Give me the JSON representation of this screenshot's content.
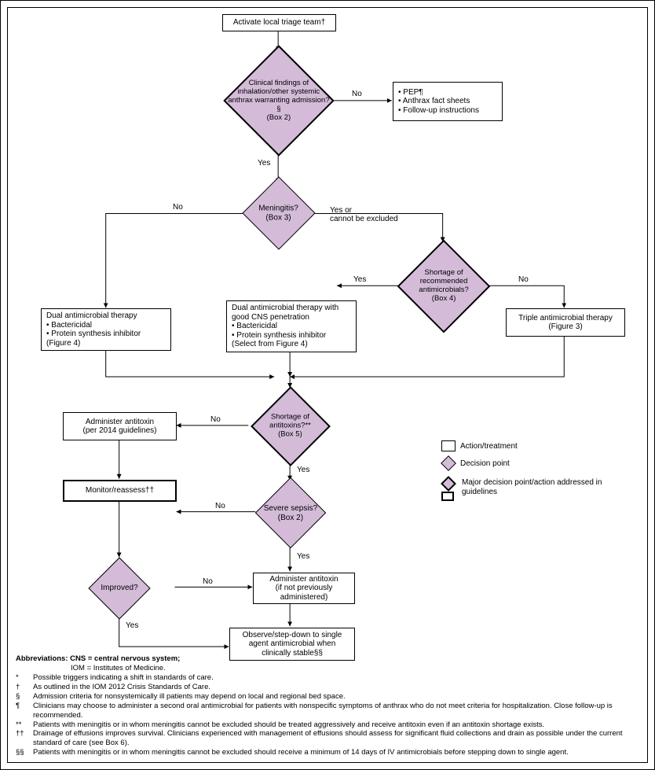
{
  "nodes": {
    "start": "Activate local triage team†",
    "d1": "Clinical findings of inhalation/other systemic anthrax warranting admission?§\n(Box 2)",
    "out_no1_a": "PEP¶",
    "out_no1_b": "Anthrax fact sheets",
    "out_no1_c": "Follow-up instructions",
    "d2": "Meningitis?\n(Box 3)",
    "d3": "Shortage of recommended antimicrobials?\n(Box 4)",
    "box_dual": "Dual antimicrobial therapy",
    "box_dual_a": "Bactericidal",
    "box_dual_b": "Protein synthesis inhibitor\n(Figure 4)",
    "box_dualcns": "Dual antimicrobial therapy with good CNS penetration",
    "box_dualcns_a": "Bactericidal",
    "box_dualcns_b": "Protein synthesis inhibitor\n(Select from Figure 4)",
    "box_triple": "Triple antimicrobial therapy\n(Figure 3)",
    "d4": "Shortage of antitoxins?**\n(Box 5)",
    "box_admin_anti": "Administer antitoxin\n(per 2014 guidelines)",
    "box_monitor": "Monitor/reassess††",
    "d5": "Severe sepsis?\n(Box 2)",
    "d6": "Improved?",
    "box_admin2": "Administer antitoxin\n(if not previously administered)",
    "box_observe": "Observe/step-down to single agent antimicrobial when clinically stable§§"
  },
  "labels": {
    "no": "No",
    "yes": "Yes",
    "yes_or": "Yes or\ncannot be excluded"
  },
  "legend": {
    "a": "Action/treatment",
    "b": "Decision point",
    "c": "Major decision point/action addressed in guidelines"
  },
  "foot": {
    "abbr": "Abbreviations: CNS = central nervous system;",
    "abbr2": "IOM = Institutes of Medicine.",
    "star": "Possible triggers indicating a shift in standards of care.",
    "dag": "As outlined in the IOM 2012 Crisis Standards of Care.",
    "sec": "Admission criteria for nonsystemically ill patients may depend on local and regional bed space.",
    "para": "Clinicians may choose to administer a second oral antimicrobial for patients with nonspecific symptoms of anthrax who do not meet criteria for hospitalization. Close follow-up is recommended.",
    "dstar": "Patients with meningitis or in whom meningitis cannot be excluded should be treated aggressively and receive antitoxin even if an antitoxin shortage exists.",
    "ddag": "Drainage of effusions improves survival. Clinicians experienced with management of effusions should assess for significant fluid collections and drain as possible under the current standard of care (see Box 6).",
    "dsec": "Patients with meningitis or in whom meningitis cannot be excluded should receive a minimum of 14 days of IV antimicrobials before stepping down to single agent."
  },
  "chart_data": {
    "type": "flowchart",
    "nodes": [
      {
        "id": "start",
        "kind": "action",
        "text": "Activate local triage team†"
      },
      {
        "id": "d1",
        "kind": "decision_major",
        "text": "Clinical findings of inhalation/other systemic anthrax warranting admission?§ (Box 2)"
      },
      {
        "id": "pep",
        "kind": "action",
        "text": "PEP¶ / Anthrax fact sheets / Follow-up instructions"
      },
      {
        "id": "d2",
        "kind": "decision",
        "text": "Meningitis? (Box 3)"
      },
      {
        "id": "d3",
        "kind": "decision_major",
        "text": "Shortage of recommended antimicrobials? (Box 4)"
      },
      {
        "id": "dual",
        "kind": "action",
        "text": "Dual antimicrobial therapy • Bactericidal • Protein synthesis inhibitor (Figure 4)"
      },
      {
        "id": "dualcns",
        "kind": "action",
        "text": "Dual antimicrobial therapy with good CNS penetration • Bactericidal • Protein synthesis inhibitor (Select from Figure 4)"
      },
      {
        "id": "triple",
        "kind": "action",
        "text": "Triple antimicrobial therapy (Figure 3)"
      },
      {
        "id": "d4",
        "kind": "decision_major",
        "text": "Shortage of antitoxins?** (Box 5)"
      },
      {
        "id": "admin1",
        "kind": "action",
        "text": "Administer antitoxin (per 2014 guidelines)"
      },
      {
        "id": "monitor",
        "kind": "action_major",
        "text": "Monitor/reassess††"
      },
      {
        "id": "d5",
        "kind": "decision",
        "text": "Severe sepsis? (Box 2)"
      },
      {
        "id": "d6",
        "kind": "decision",
        "text": "Improved?"
      },
      {
        "id": "admin2",
        "kind": "action",
        "text": "Administer antitoxin (if not previously administered)"
      },
      {
        "id": "observe",
        "kind": "action",
        "text": "Observe/step-down to single agent antimicrobial when clinically stable§§"
      }
    ],
    "edges": [
      {
        "from": "start",
        "to": "d1"
      },
      {
        "from": "d1",
        "to": "pep",
        "label": "No"
      },
      {
        "from": "d1",
        "to": "d2",
        "label": "Yes"
      },
      {
        "from": "d2",
        "to": "dual",
        "label": "No"
      },
      {
        "from": "d2",
        "to": "d3",
        "label": "Yes or cannot be excluded"
      },
      {
        "from": "d3",
        "to": "dualcns",
        "label": "Yes"
      },
      {
        "from": "d3",
        "to": "triple",
        "label": "No"
      },
      {
        "from": "dual",
        "to": "d4"
      },
      {
        "from": "dualcns",
        "to": "d4"
      },
      {
        "from": "triple",
        "to": "d4"
      },
      {
        "from": "d4",
        "to": "admin1",
        "label": "No"
      },
      {
        "from": "d4",
        "to": "d5",
        "label": "Yes"
      },
      {
        "from": "admin1",
        "to": "monitor"
      },
      {
        "from": "d5",
        "to": "monitor",
        "label": "No"
      },
      {
        "from": "d5",
        "to": "admin2",
        "label": "Yes"
      },
      {
        "from": "monitor",
        "to": "d6"
      },
      {
        "from": "d6",
        "to": "admin2",
        "label": "No"
      },
      {
        "from": "d6",
        "to": "observe",
        "label": "Yes"
      },
      {
        "from": "admin2",
        "to": "observe"
      }
    ]
  }
}
